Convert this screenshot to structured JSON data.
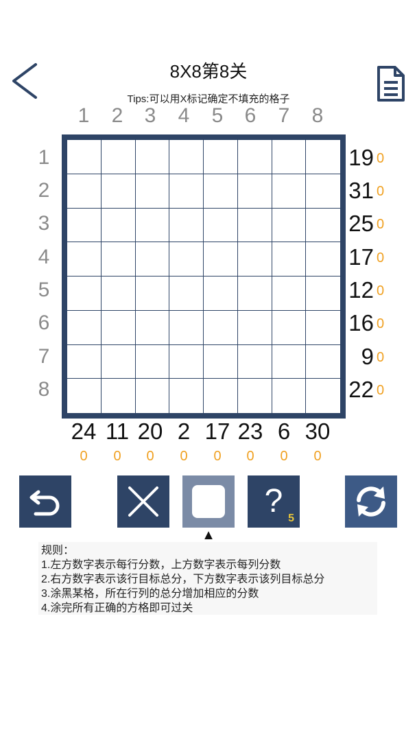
{
  "header": {
    "title": "8X8第8关",
    "tips": "Tips:可以用X标记确定不填充的格子"
  },
  "puzzle": {
    "column_headers": [
      "1",
      "2",
      "3",
      "4",
      "5",
      "6",
      "7",
      "8"
    ],
    "row_headers": [
      "1",
      "2",
      "3",
      "4",
      "5",
      "6",
      "7",
      "8"
    ],
    "row_targets": [
      "19",
      "31",
      "25",
      "17",
      "12",
      "16",
      "9",
      "22"
    ],
    "row_scores": [
      "0",
      "0",
      "0",
      "0",
      "0",
      "0",
      "0",
      "0"
    ],
    "column_targets": [
      "24",
      "11",
      "20",
      "2",
      "17",
      "23",
      "6",
      "30"
    ],
    "column_scores": [
      "0",
      "0",
      "0",
      "0",
      "0",
      "0",
      "0",
      "0"
    ],
    "filled_cells": 0
  },
  "toolbar": {
    "undo": "undo-icon",
    "mark_x": "x-icon",
    "fill": "square-icon",
    "hint": "?",
    "hint_count": "5",
    "restart": "refresh-icon",
    "selected_tool": "fill",
    "pointer": "▲"
  },
  "rules": {
    "heading": "规则：",
    "lines": [
      "1.左方数字表示每行分数，上方数字表示每列分数",
      "2.右方数字表示该行目标总分，下方数字表示该列目标总分",
      "3.涂黑某格，所在行列的总分增加相应的分数",
      "4.涂完所有正确的方格即可过关"
    ]
  },
  "colors": {
    "board": "#2e4466",
    "tool": "#2e4466",
    "tool_selected": "#7b8ba6",
    "score": "#f0a020",
    "header_numbers": "#8a8a8a",
    "hint_badge": "#e8c53a"
  }
}
